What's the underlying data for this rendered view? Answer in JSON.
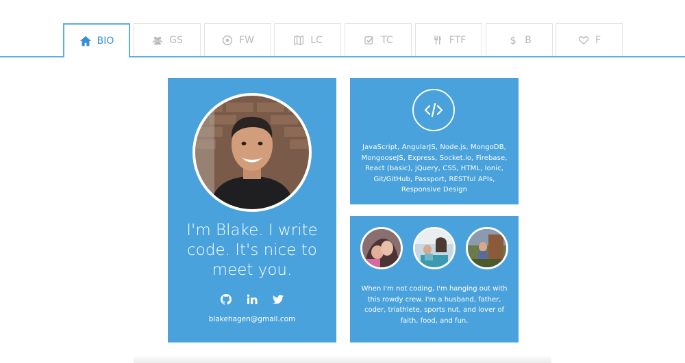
{
  "tabs": [
    {
      "label": "BIO",
      "icon": "home-icon",
      "active": true
    },
    {
      "label": "GS",
      "icon": "users-icon"
    },
    {
      "label": "FW",
      "icon": "soccer-ball-icon"
    },
    {
      "label": "LC",
      "icon": "map-icon"
    },
    {
      "label": "TC",
      "icon": "checkbox-icon"
    },
    {
      "label": "FTF",
      "icon": "cutlery-icon"
    },
    {
      "label": "B",
      "icon": "dollar-icon"
    },
    {
      "label": "F",
      "icon": "heart-icon"
    }
  ],
  "bio": {
    "headline": "I'm Blake. I write code. It's nice to meet you.",
    "social_icons": [
      "github-icon",
      "linkedin-icon",
      "twitter-icon"
    ],
    "email": "blakehagen@gmail.com"
  },
  "skills": {
    "icon": "code-icon",
    "text": "JavaScript, AngularJS, Node.js, MongoDB, MongooseJS, Express, Socket.io, Firebase, React (basic), jQuery, CSS, HTML, Ionic, Git/GitHub, Passport, RESTful APIs, Responsive Design"
  },
  "family": {
    "text": "When I'm not coding, I'm hanging out with this rowdy crew. I'm a husband, father, coder, triathlete, sports nut, and lover of faith, food, and fun."
  },
  "colors": {
    "accent": "#4aa2dc",
    "tab_active": "#3a8fd1",
    "tab_inactive": "#b9b9b9"
  }
}
